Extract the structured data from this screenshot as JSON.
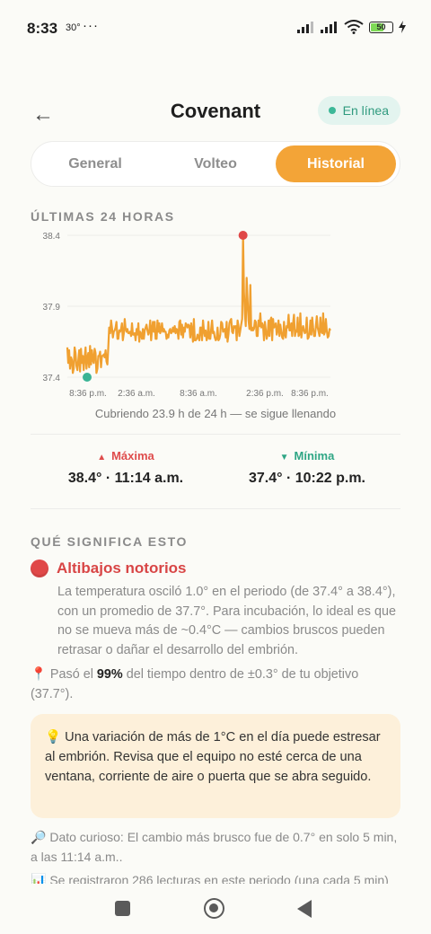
{
  "status_bar": {
    "time": "8:33",
    "temp": "30°",
    "dots": "···",
    "battery": "50"
  },
  "header": {
    "back_icon": "←",
    "title": "Covenant",
    "status": "En línea"
  },
  "tabs": [
    {
      "label": "General",
      "active": false
    },
    {
      "label": "Volteo",
      "active": false
    },
    {
      "label": "Historial",
      "active": true
    }
  ],
  "section_24h": "ÚLTIMAS 24 HORAS",
  "chart_data": {
    "type": "line",
    "x_ticks": [
      "8:36 p.m.",
      "2:36 a.m.",
      "8:36 a.m.",
      "2:36 p.m.",
      "8:36 p.m."
    ],
    "y_ticks": [
      38.4,
      37.9,
      37.4
    ],
    "ylim": [
      37.4,
      38.4
    ],
    "series": [
      {
        "color": "#f0a030",
        "values": [
          37.61,
          37.5,
          37.59,
          37.46,
          37.54,
          37.52,
          37.43,
          37.46,
          37.61,
          37.57,
          37.48,
          37.45,
          37.52,
          37.59,
          37.44,
          37.6,
          37.5,
          37.55,
          37.45,
          37.54,
          37.61,
          37.46,
          37.53,
          37.57,
          37.47,
          37.62,
          37.49,
          37.59,
          37.52,
          37.5,
          37.6,
          37.57,
          37.43,
          37.46,
          37.55,
          37.55,
          37.58,
          37.47,
          37.55,
          37.55,
          37.56,
          37.54,
          37.59,
          37.51,
          37.49,
          37.61,
          37.75,
          37.71,
          37.8,
          37.75,
          37.68,
          37.72,
          37.73,
          37.75,
          37.79,
          37.67,
          37.67,
          37.73,
          37.72,
          37.74,
          37.78,
          37.66,
          37.71,
          37.81,
          37.74,
          37.72,
          37.74,
          37.71,
          37.71,
          37.72,
          37.69,
          37.78,
          37.7,
          37.7,
          37.71,
          37.66,
          37.74,
          37.7,
          37.78,
          37.65,
          37.72,
          37.7,
          37.67,
          37.74,
          37.67,
          37.73,
          37.75,
          37.77,
          37.73,
          37.7,
          37.72,
          37.8,
          37.66,
          37.74,
          37.79,
          37.72,
          37.79,
          37.67,
          37.67,
          37.8,
          37.72,
          37.78,
          37.71,
          37.73,
          37.78,
          37.72,
          37.74,
          37.72,
          37.72,
          37.67,
          37.7,
          37.68,
          37.73,
          37.74,
          37.71,
          37.72,
          37.75,
          37.72,
          37.76,
          37.71,
          37.74,
          37.73,
          37.67,
          37.79,
          37.8,
          37.7,
          37.77,
          37.68,
          37.75,
          37.72,
          37.78,
          37.77,
          37.75,
          37.77,
          37.76,
          37.68,
          37.78,
          37.73,
          37.65,
          37.81,
          37.66,
          37.66,
          37.67,
          37.7,
          37.68,
          37.66,
          37.75,
          37.75,
          37.66,
          37.8,
          37.73,
          37.69,
          37.73,
          37.66,
          37.68,
          37.79,
          37.67,
          37.67,
          37.74,
          37.8,
          37.71,
          37.72,
          37.68,
          37.66,
          37.67,
          37.75,
          37.66,
          37.67,
          37.7,
          37.79,
          37.78,
          37.72,
          37.73,
          37.74,
          37.68,
          37.79,
          37.65,
          37.7,
          37.78,
          37.8,
          37.81,
          37.72,
          37.71,
          37.76,
          37.75,
          37.76,
          37.66,
          37.8,
          37.76,
          37.69,
          37.73,
          37.77,
          37.81,
          38.4,
          38.0,
          37.85,
          37.76,
          38.1,
          37.95,
          37.8,
          37.74,
          38.05,
          37.73,
          37.75,
          37.73,
          37.74,
          37.8,
          37.79,
          37.69,
          37.69,
          37.8,
          37.76,
          37.85,
          37.75,
          37.78,
          37.76,
          37.66,
          37.79,
          37.73,
          37.67,
          37.7,
          37.8,
          37.69,
          37.8,
          37.82,
          37.66,
          37.81,
          37.75,
          37.76,
          37.78,
          37.7,
          37.73,
          37.8,
          37.69,
          37.77,
          37.72,
          37.68,
          37.67,
          37.79,
          37.7,
          37.68,
          37.76,
          37.75,
          37.84,
          37.73,
          37.73,
          37.78,
          37.69,
          37.78,
          37.84,
          37.69,
          37.73,
          37.72,
          37.82,
          37.69,
          37.7,
          37.85,
          37.68,
          37.73,
          37.76,
          37.73,
          37.71,
          37.72,
          37.82,
          37.67,
          37.68,
          37.71,
          37.8,
          37.7,
          37.82,
          37.75,
          37.69,
          37.69,
          37.76,
          37.83,
          37.75,
          37.72,
          37.69,
          37.82,
          37.72,
          37.71,
          37.85,
          37.7,
          37.72,
          37.81,
          37.73,
          37.68,
          37.69,
          37.74,
          37.73
        ]
      }
    ],
    "markers": {
      "max": {
        "value": 38.4,
        "color": "#e04848"
      },
      "min": {
        "value": 37.4,
        "color": "#3ab495"
      }
    }
  },
  "chart_caption": "Cubriendo 23.9 h de 24 h — se sigue llenando",
  "stats": {
    "max_label": "Máxima",
    "max_value": "38.4° · 11:14 a.m.",
    "min_label": "Mínima",
    "min_value": "37.4° · 10:22 p.m."
  },
  "meaning": {
    "section_title": "QUÉ SIGNIFICA ESTO",
    "headline": "Altibajos notorios",
    "body": "La temperatura osciló 1.0° en el periodo (de 37.4° a 38.4°), con un promedio de 37.7°. Para incubación, lo ideal es que no se mueva más de ~0.4°C — cambios bruscos pueden retrasar o dañar el desarrollo del embrión.",
    "pin_prefix": "Pasó el",
    "pin_percent": "99%",
    "pin_suffix": "del tiempo dentro de ±0.3° de tu objetivo (37.7°).",
    "tip": "Una variación de más de 1°C en el día puede estresar al embrión. Revisa que el equipo no esté cerca de una ventana, corriente de aire o puerta que se abra seguido.",
    "curious": "Dato curioso: El cambio más brusco fue de 0.7° en solo 5 min, a las 11:14 a.m..",
    "records": "Se registraron 286 lecturas en este periodo (una cada 5 min)"
  },
  "icons": {
    "back": "arrow-left-icon",
    "online": "online-dot-icon",
    "max": "triangle-up-icon",
    "min": "triangle-down-icon",
    "headline": "red-circle-icon",
    "pin": "pushpin-icon",
    "tip": "lightbulb-icon",
    "curious": "magnifier-icon",
    "records": "bar-chart-icon"
  }
}
